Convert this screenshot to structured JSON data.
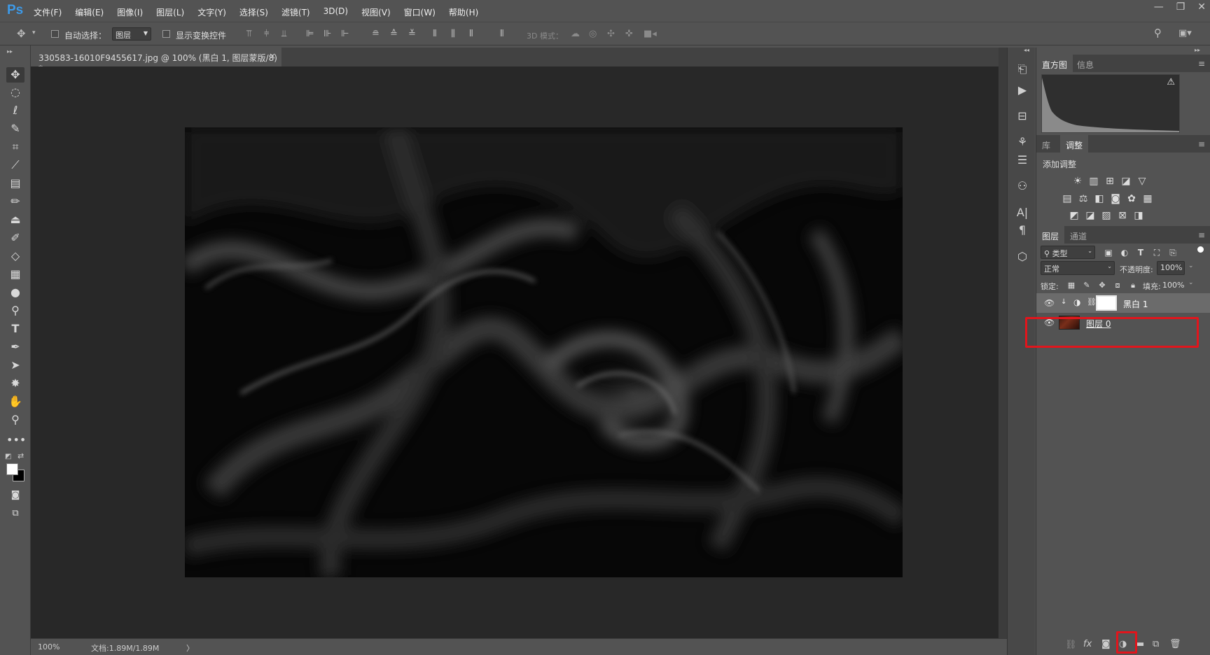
{
  "app": {
    "logo": "Ps",
    "accent": "#3d9ae8",
    "highlight_color": "#e1151c"
  },
  "menus": [
    "文件(F)",
    "编辑(E)",
    "图像(I)",
    "图层(L)",
    "文字(Y)",
    "选择(S)",
    "滤镜(T)",
    "3D(D)",
    "视图(V)",
    "窗口(W)",
    "帮助(H)"
  ],
  "window_controls": [
    "—",
    "❐",
    "✕"
  ],
  "options_bar": {
    "auto_select_label": "自动选择：",
    "auto_select_target": "图层",
    "show_transform_label": "显示变换控件",
    "mode_3d_label": "3D 模式："
  },
  "document": {
    "tab_title": "330583-16010F9455617.jpg @ 100% (黑白 1, 图层蒙版/8) *",
    "tab_close": "×"
  },
  "status": {
    "zoom": "100%",
    "doc_info": "文档:1.89M/1.89M",
    "arrow": "〉"
  },
  "panels": {
    "histogram": {
      "tabs": [
        "直方图",
        "信息"
      ],
      "active": 0,
      "warning_icon": "⚠"
    },
    "adjustments": {
      "tabs": [
        "库",
        "调整"
      ],
      "active": 1,
      "add_label": "添加调整"
    },
    "layers": {
      "tabs": [
        "图层",
        "通道"
      ],
      "active": 0,
      "filter_kind": "类型",
      "blend_mode": "正常",
      "opacity_label": "不透明度:",
      "opacity_value": "100%",
      "lock_label": "锁定:",
      "fill_label": "填充:",
      "fill_value": "100%",
      "items": [
        {
          "name": "黑白 1",
          "type": "adjustment",
          "selected": true
        },
        {
          "name": "图层 0",
          "type": "image",
          "selected": false
        }
      ]
    }
  }
}
